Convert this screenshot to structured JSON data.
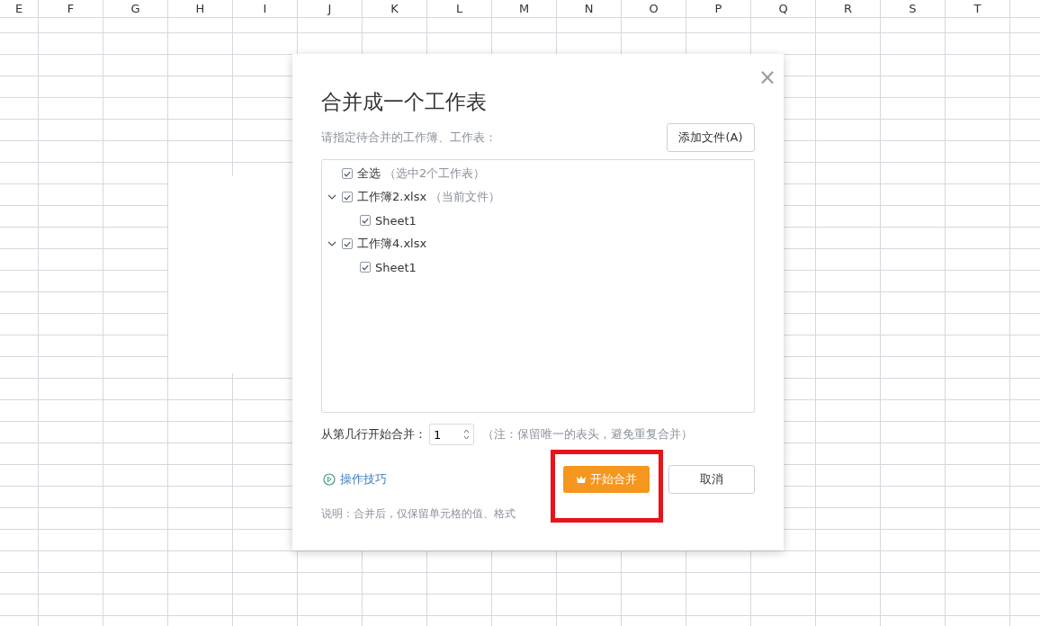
{
  "sheet": {
    "columns": [
      "E",
      "F",
      "G",
      "H",
      "I",
      "J",
      "K",
      "L",
      "M",
      "N",
      "O",
      "P",
      "Q",
      "R",
      "S",
      "T"
    ]
  },
  "dialog": {
    "title": "合并成一个工作表",
    "close": "×",
    "instruction": "请指定待合并的工作簿、工作表：",
    "add_button": "添加文件(A)",
    "tree": [
      {
        "label": "全选",
        "note": "（选中2个工作表）",
        "checked": true
      },
      {
        "label": "工作簿2.xlsx",
        "note": "（当前文件）",
        "checked": true,
        "expanded": true,
        "children": [
          {
            "label": "Sheet1",
            "checked": true
          }
        ]
      },
      {
        "label": "工作簿4.xlsx",
        "checked": true,
        "expanded": true,
        "children": [
          {
            "label": "Sheet1",
            "checked": true
          }
        ]
      }
    ],
    "start_row_label": "从第几行开始合并：",
    "start_row_value": "1",
    "start_row_note": "（注：保留唯一的表头，避免重复合并）",
    "tips_link": "操作技巧",
    "merge_button": "开始合并",
    "cancel_button": "取消",
    "footnote": "说明：合并后，仅保留单元格的值、格式"
  }
}
